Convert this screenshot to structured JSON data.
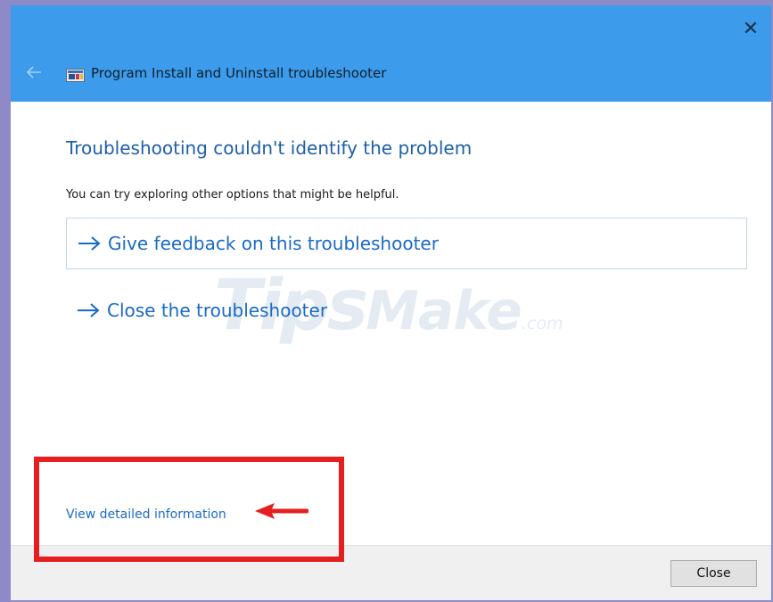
{
  "window": {
    "title": "Program Install and Uninstall troubleshooter",
    "close_glyph": "✕"
  },
  "content": {
    "heading": "Troubleshooting couldn't identify the problem",
    "subtext": "You can try exploring other options that might be helpful.",
    "options": [
      {
        "label": "Give feedback on this troubleshooter"
      },
      {
        "label": "Close the troubleshooter"
      }
    ],
    "detail_link": "View detailed information"
  },
  "footer": {
    "close_label": "Close"
  },
  "watermark": {
    "part1": "Tips",
    "part2": "Make",
    "part3": ".com"
  },
  "icons": {
    "back": "back-arrow-icon",
    "app": "troubleshooter-app-icon",
    "option_arrow": "arrow-right-icon",
    "annotation_arrow": "red-arrow-icon"
  },
  "colors": {
    "titlebar": "#3c9ceb",
    "link": "#1a6ac6",
    "heading": "#1e5fa8",
    "annotation": "#e51f1f"
  }
}
